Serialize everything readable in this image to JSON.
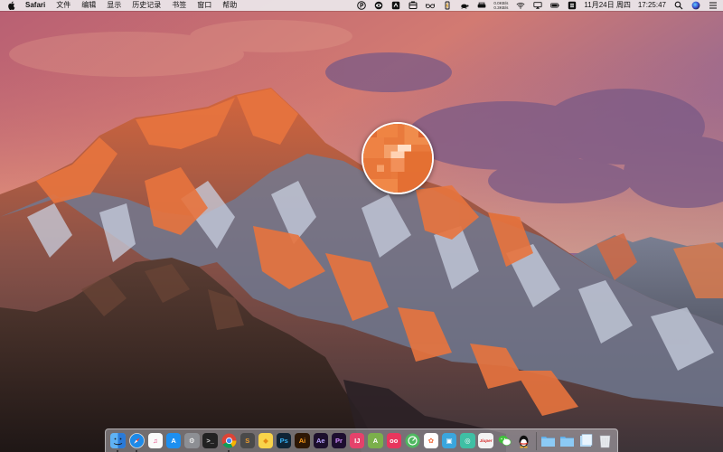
{
  "menubar": {
    "app_name": "Safari",
    "menus": [
      "文件",
      "编辑",
      "显示",
      "历史记录",
      "书签",
      "窗口",
      "帮助"
    ],
    "status_icons": [
      "parking-icon",
      "eye-icon",
      "sync-icon",
      "bin-icon",
      "glasses-icon",
      "battery-charging-icon",
      "turtle-icon",
      "scanner-icon"
    ],
    "net_up": "0.0KB/s",
    "net_down": "0.3KB/s",
    "date": "11月24日 周四",
    "time": "17:25:47"
  },
  "dock": {
    "apps": [
      {
        "name": "finder",
        "label": "",
        "bg": "#2f8ae8",
        "fg": "#ffffff",
        "running": true
      },
      {
        "name": "safari",
        "label": "",
        "bg": "#1f86e6",
        "fg": "#ffffff",
        "running": true
      },
      {
        "name": "itunes",
        "label": "♫",
        "bg": "#fafafa",
        "fg": "#e13a7a",
        "running": false
      },
      {
        "name": "app-store",
        "label": "A",
        "bg": "#1d8ff0",
        "fg": "#ffffff",
        "running": false
      },
      {
        "name": "system-preferences",
        "label": "⚙",
        "bg": "#8d8f94",
        "fg": "#ffffff",
        "running": false
      },
      {
        "name": "terminal",
        "label": ">_",
        "bg": "#222222",
        "fg": "#d8d8d8",
        "running": false
      },
      {
        "name": "chrome",
        "label": "",
        "bg": "#ffffff",
        "fg": "#ffffff",
        "running": true
      },
      {
        "name": "sublime-text",
        "label": "S",
        "bg": "#4a4a4a",
        "fg": "#f09e2c",
        "running": false
      },
      {
        "name": "sketch",
        "label": "◆",
        "bg": "#f8d34a",
        "fg": "#e48b14",
        "running": false
      },
      {
        "name": "photoshop",
        "label": "Ps",
        "bg": "#0f2436",
        "fg": "#36b0f4",
        "running": false
      },
      {
        "name": "illustrator",
        "label": "Ai",
        "bg": "#2d1705",
        "fg": "#f99b1c",
        "running": false
      },
      {
        "name": "after-effects",
        "label": "Ae",
        "bg": "#1c0f2c",
        "fg": "#b9a4ff",
        "running": false
      },
      {
        "name": "premiere",
        "label": "Pr",
        "bg": "#1d0e2f",
        "fg": "#d08cff",
        "running": false
      },
      {
        "name": "intellij",
        "label": "IJ",
        "bg": "#e5426b",
        "fg": "#ffffff",
        "running": false
      },
      {
        "name": "android-studio",
        "label": "A",
        "bg": "#7bb04b",
        "fg": "#ffffff",
        "running": false
      },
      {
        "name": "flickr-uploader",
        "label": "oo",
        "bg": "#e8365d",
        "fg": "#ffffff",
        "running": false
      },
      {
        "name": "xcode-instruments",
        "label": "",
        "bg": "#4fb860",
        "fg": "#ffffff",
        "running": false
      },
      {
        "name": "photos",
        "label": "✿",
        "bg": "#ffffff",
        "fg": "#f06a3a",
        "running": false
      },
      {
        "name": "preview",
        "label": "▣",
        "bg": "#3aa6dd",
        "fg": "#ffffff",
        "running": false
      },
      {
        "name": "cloud-service",
        "label": "◎",
        "bg": "#3fbfa4",
        "fg": "#ffffff",
        "running": false
      },
      {
        "name": "jumper",
        "label": "Jiuper",
        "bg": "#f3f3f3",
        "fg": "#d62d2d",
        "running": false
      },
      {
        "name": "wechat",
        "label": "",
        "bg": "#e9e9e9",
        "fg": "#3fc13a",
        "running": false
      },
      {
        "name": "qq",
        "label": "",
        "bg": "#ececec",
        "fg": "#111111",
        "running": false
      }
    ],
    "folders": [
      {
        "name": "applications-folder",
        "bg": "#62b1ec"
      },
      {
        "name": "documents-folder",
        "bg": "#62b1ec"
      },
      {
        "name": "downloads-folder",
        "bg": "#7cc0f0"
      }
    ],
    "trash": {
      "name": "trash"
    }
  }
}
